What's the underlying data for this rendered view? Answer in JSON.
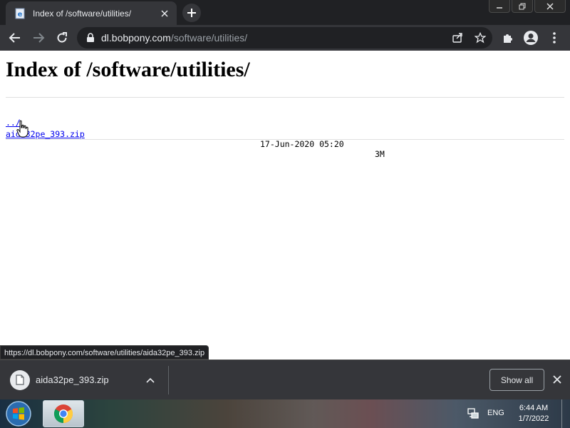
{
  "browser": {
    "tab": {
      "title": "Index of /software/utilities/",
      "favicon": "ie-page-icon"
    },
    "window_controls": [
      "minimize-icon",
      "restore-icon",
      "close-icon"
    ],
    "toolbar": {
      "url_host": "dl.bobpony.com",
      "url_path": "/software/utilities/"
    }
  },
  "page": {
    "title": "Index of /software/utilities/",
    "entries": [
      {
        "name": "../",
        "date": "",
        "size": ""
      },
      {
        "name": "aida32pe_393.zip",
        "date": "17-Jun-2020 05:20",
        "size": "3M"
      }
    ]
  },
  "status_bar": {
    "url": "https://dl.bobpony.com/software/utilities/aida32pe_393.zip"
  },
  "download_shelf": {
    "item_name": "aida32pe_393.zip",
    "show_all_label": "Show all"
  },
  "taskbar": {
    "language": "ENG",
    "time": "6:44 AM",
    "date": "1/7/2022"
  },
  "colors": {
    "chrome_dark": "#202124",
    "chrome_toolbar": "#35363a",
    "link": "#0000ee"
  }
}
